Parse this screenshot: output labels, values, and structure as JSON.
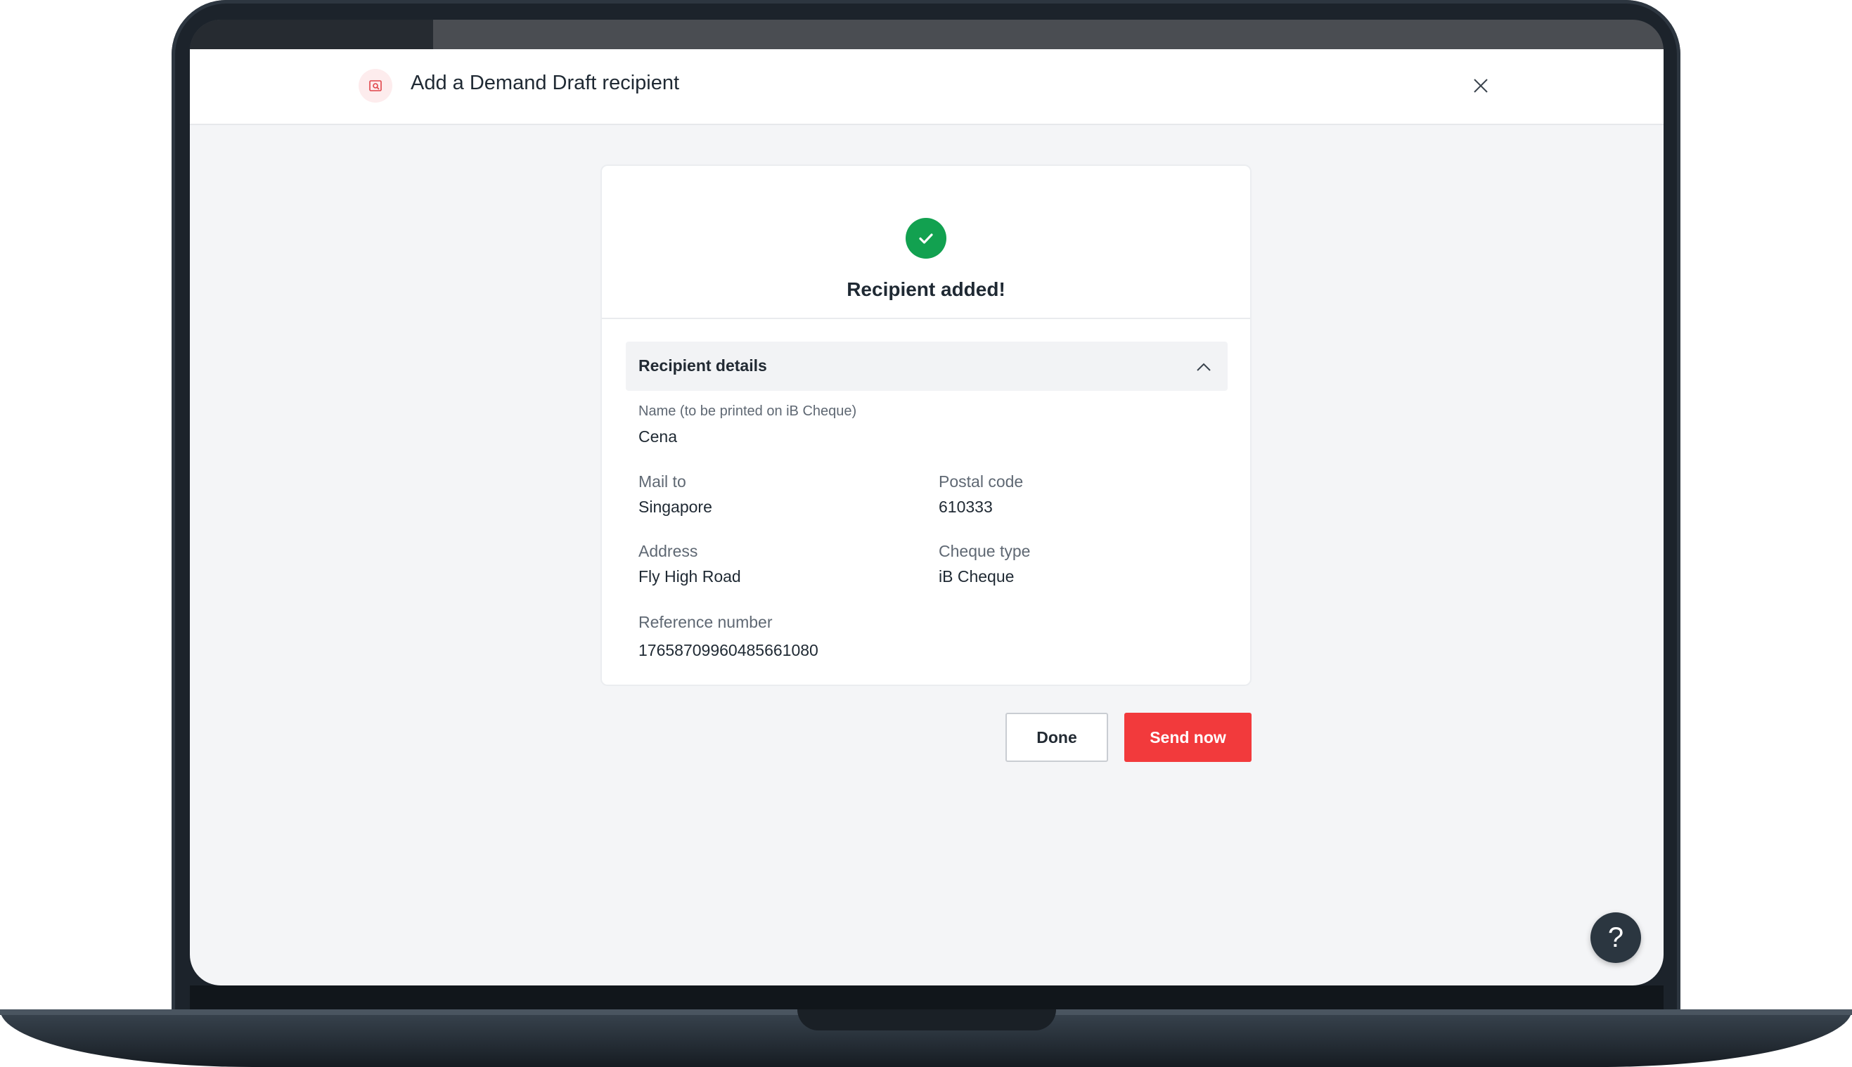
{
  "header": {
    "title": "Add a Demand Draft recipient",
    "icon": "cheque-icon",
    "close_icon": "close-icon"
  },
  "success": {
    "icon": "check-circle-icon",
    "title": "Recipient added!"
  },
  "recipient_details": {
    "section_title": "Recipient details",
    "expanded": true,
    "fields": {
      "name_label": "Name (to be printed on iB Cheque)",
      "name_value": "Cena",
      "mail_to_label": "Mail to",
      "mail_to_value": "Singapore",
      "postal_code_label": "Postal code",
      "postal_code_value": "610333",
      "address_label": "Address",
      "address_value": "Fly High Road",
      "cheque_type_label": "Cheque type",
      "cheque_type_value": "iB Cheque",
      "reference_label": "Reference number",
      "reference_value": "17658709960485661080"
    }
  },
  "actions": {
    "done_label": "Done",
    "send_now_label": "Send now"
  },
  "help": {
    "label": "?"
  },
  "colors": {
    "brand_red": "#f23a3c",
    "success_green": "#12a150",
    "help_dark": "#2b3640"
  }
}
